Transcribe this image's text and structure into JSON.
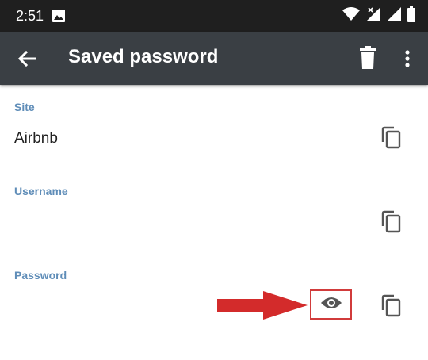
{
  "status_bar": {
    "time": "2:51",
    "icons": [
      "image-icon",
      "wifi-icon",
      "signal-x-icon",
      "signal-icon",
      "battery-icon"
    ]
  },
  "app_bar": {
    "title": "Saved password",
    "icons": [
      "back-arrow-icon",
      "trash-icon",
      "more-vert-icon"
    ]
  },
  "fields": {
    "site": {
      "label": "Site",
      "value": "Airbnb"
    },
    "username": {
      "label": "Username",
      "value": ""
    },
    "password": {
      "label": "Password",
      "value": ""
    }
  },
  "annotation": {
    "arrow_color": "#d32b2b",
    "highlight_color": "#d13b3b"
  },
  "colors": {
    "status_bar_bg": "#1f1f1f",
    "app_bar_bg": "#3a3f44",
    "label_color": "#5f8db8",
    "icon_gray": "#555555"
  }
}
